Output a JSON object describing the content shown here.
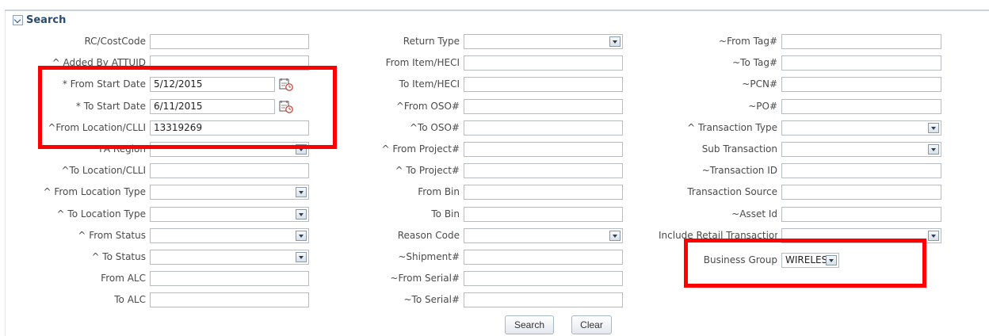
{
  "section": {
    "title": "Search"
  },
  "col1": [
    {
      "label": "RC/CostCode",
      "type": "text",
      "value": ""
    },
    {
      "label": "^ Added By ATTUID",
      "type": "text",
      "value": ""
    },
    {
      "label": "* From Start Date",
      "type": "date",
      "value": "5/12/2015"
    },
    {
      "label": "* To Start Date",
      "type": "date",
      "value": "6/11/2015"
    },
    {
      "label": "^From Location/CLLI",
      "type": "text",
      "value": "13319269"
    },
    {
      "label": "^ FA Region",
      "type": "select",
      "value": ""
    },
    {
      "label": "^To Location/CLLI",
      "type": "text",
      "value": ""
    },
    {
      "label": "^ From Location Type",
      "type": "select",
      "value": ""
    },
    {
      "label": "^ To Location Type",
      "type": "select",
      "value": ""
    },
    {
      "label": "^ From Status",
      "type": "select",
      "value": ""
    },
    {
      "label": "^ To Status",
      "type": "select",
      "value": ""
    },
    {
      "label": "From ALC",
      "type": "text",
      "value": ""
    },
    {
      "label": "To ALC",
      "type": "text",
      "value": ""
    }
  ],
  "col2": [
    {
      "label": "Return Type",
      "type": "select",
      "value": ""
    },
    {
      "label": "From Item/HECI",
      "type": "text",
      "value": ""
    },
    {
      "label": "To Item/HECI",
      "type": "text",
      "value": ""
    },
    {
      "label": "^From OSO#",
      "type": "text",
      "value": ""
    },
    {
      "label": "^To OSO#",
      "type": "text",
      "value": ""
    },
    {
      "label": "^ From Project#",
      "type": "text",
      "value": ""
    },
    {
      "label": "^ To Project#",
      "type": "text",
      "value": ""
    },
    {
      "label": "From Bin",
      "type": "text",
      "value": ""
    },
    {
      "label": "To Bin",
      "type": "text",
      "value": ""
    },
    {
      "label": "Reason Code",
      "type": "select",
      "value": ""
    },
    {
      "label": "~Shipment#",
      "type": "text",
      "value": ""
    },
    {
      "label": "~From Serial#",
      "type": "text",
      "value": ""
    },
    {
      "label": "~To Serial#",
      "type": "text",
      "value": ""
    }
  ],
  "col3": [
    {
      "label": "~From Tag#",
      "type": "text",
      "value": ""
    },
    {
      "label": "~To Tag#",
      "type": "text",
      "value": ""
    },
    {
      "label": "~PCN#",
      "type": "text",
      "value": ""
    },
    {
      "label": "~PO#",
      "type": "text",
      "value": ""
    },
    {
      "label": "^ Transaction Type",
      "type": "select",
      "value": ""
    },
    {
      "label": "Sub Transaction",
      "type": "select",
      "value": ""
    },
    {
      "label": "~Transaction ID",
      "type": "text",
      "value": ""
    },
    {
      "label": "Transaction Source",
      "type": "text",
      "value": ""
    },
    {
      "label": "~Asset Id",
      "type": "text",
      "value": ""
    },
    {
      "label": "Include Retail Transaction",
      "type": "select",
      "value": ""
    },
    {
      "label": "Business Group",
      "type": "select-short",
      "value": "WIRELESS"
    }
  ],
  "buttons": {
    "search": "Search",
    "clear": "Clear"
  },
  "colors": {
    "highlight": "#ff0000",
    "label": "#4a4a4a",
    "border": "#b5bcc5"
  }
}
